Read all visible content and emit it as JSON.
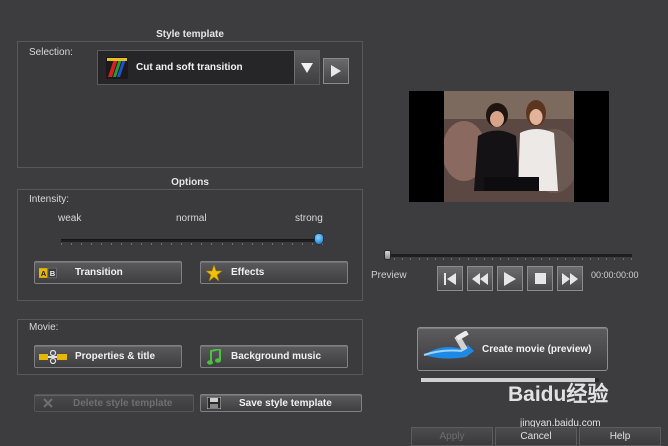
{
  "style_template": {
    "title": "Style template",
    "selection_label": "Selection:",
    "selected": "Cut and soft transition"
  },
  "options": {
    "title": "Options",
    "intensity_label": "Intensity:",
    "weak": "weak",
    "normal": "normal",
    "strong": "strong",
    "intensity_value": 1.0,
    "transition_label": "Transition",
    "effects_label": "Effects"
  },
  "movie": {
    "label": "Movie:",
    "properties_label": "Properties & title",
    "background_music_label": "Background music"
  },
  "templates": {
    "delete_label": "Delete style template",
    "save_label": "Save style template"
  },
  "preview": {
    "label": "Preview",
    "timecode": "00:00:00:00",
    "position": 0.0
  },
  "create": {
    "label": "Create movie (preview)",
    "progress": 0.98
  },
  "footer": {
    "apply": "Apply",
    "cancel": "Cancel",
    "help": "Help"
  },
  "watermark": {
    "text": "Baidu经验",
    "url": "jingyan.baidu.com"
  },
  "colors": {
    "background": "#3d3d3f",
    "accent": "#1e88e5"
  }
}
